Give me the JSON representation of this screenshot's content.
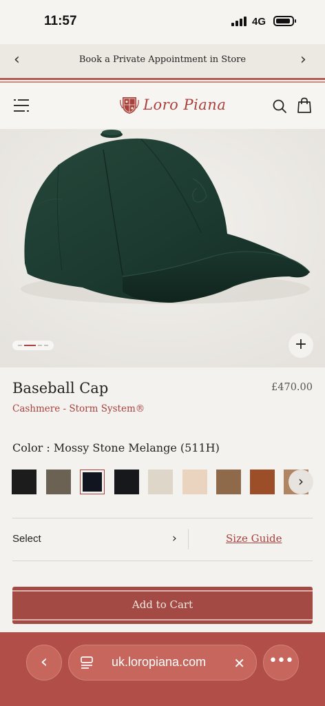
{
  "status_bar": {
    "time": "11:57",
    "network": "4G",
    "icons": [
      "signal-icon",
      "battery-icon"
    ]
  },
  "promo_banner": {
    "text": "Book a Private Appointment in Store",
    "prev_icon": "chevron-left-icon",
    "next_icon": "chevron-right-icon"
  },
  "header": {
    "brand": "Loro Piana",
    "icons": [
      "menu-icon",
      "logo-crest-icon",
      "search-icon",
      "shopping-bag-icon"
    ]
  },
  "gallery": {
    "image": "green-baseball-cap-photo",
    "current_image": 1,
    "zoom_icon": "plus-icon"
  },
  "product": {
    "title": "Baseball Cap",
    "price": "£470.00",
    "material": "Cashmere - Storm System®",
    "color_label": "Color : Mossy Stone Melange (511H)"
  },
  "swatches": {
    "colors": [
      "#1c1c1c",
      "#6b6254",
      "#10151f",
      "#16181b",
      "#ddd6c9",
      "#ead3bf",
      "#8f6a4a",
      "#9c4e29",
      "#b08563"
    ],
    "selected_index": 2,
    "next_icon": "chevron-right-icon"
  },
  "size": {
    "select_label": "Select",
    "size_guide_label": "Size Guide"
  },
  "cta": {
    "add_to_cart_label": "Add to Cart"
  },
  "browser": {
    "url": "uk.loropiana.com",
    "icons": [
      "back-icon",
      "tabs-icon",
      "clear-icon",
      "more-icon"
    ]
  },
  "colors": {
    "brand_red": "#a8413d",
    "cta_red": "#a24a43",
    "browser_bar": "#b04e47",
    "cap_green": "#1d3a30"
  }
}
